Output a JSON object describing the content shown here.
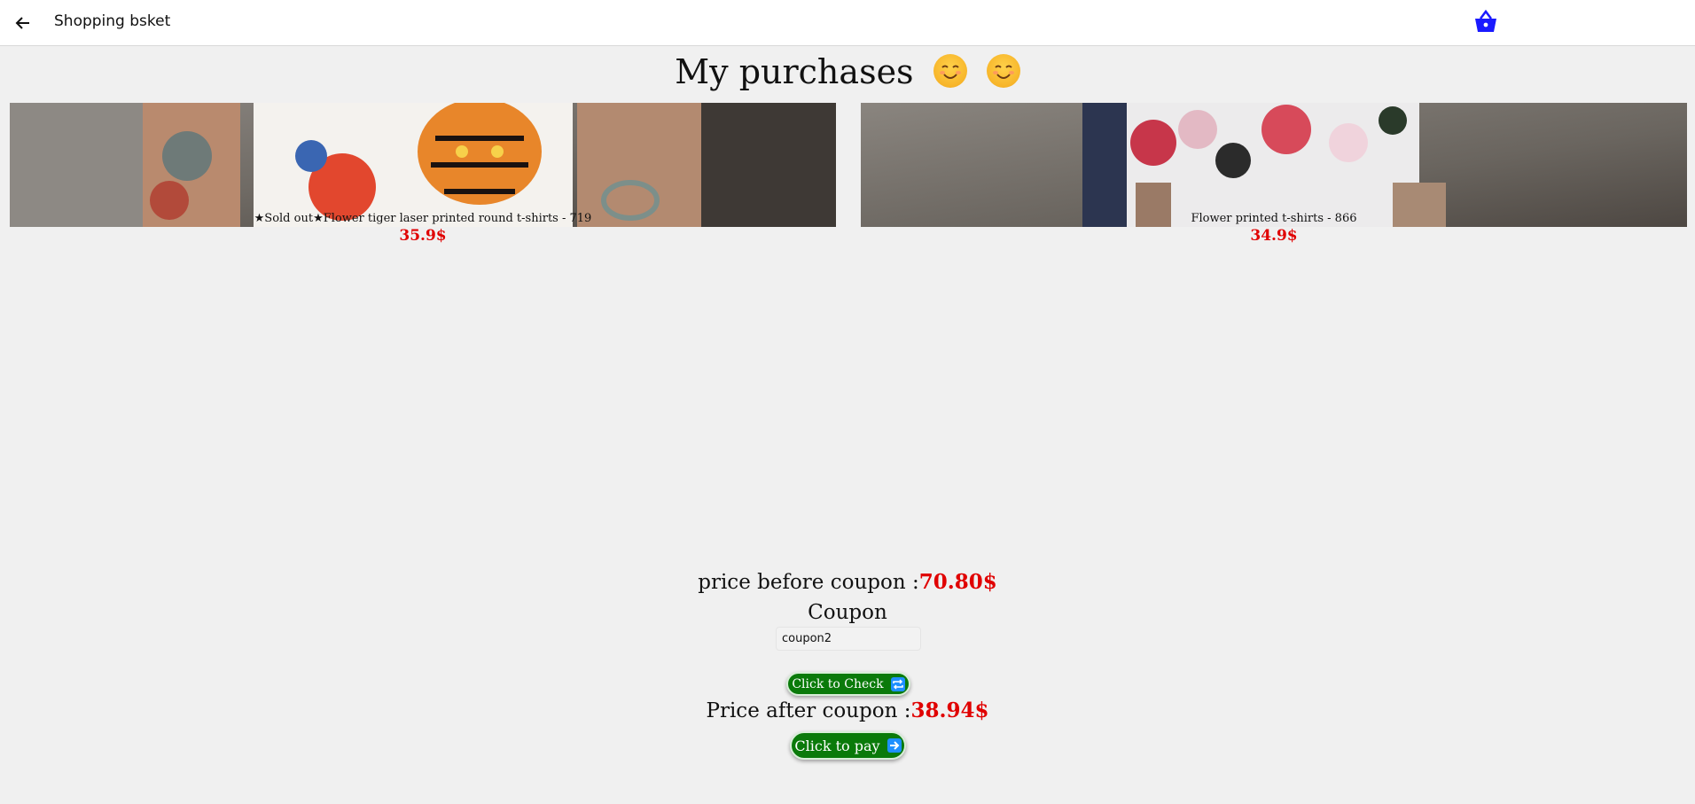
{
  "appbar": {
    "title": "Shopping bsket"
  },
  "page": {
    "title": "My purchases"
  },
  "products": [
    {
      "caption": "★Sold out★Flower tiger laser printed round t-shirts - 719",
      "price": "35.9$"
    },
    {
      "caption": "Flower printed t-shirts - 866",
      "price": "34.9$"
    }
  ],
  "summary": {
    "before_label": "price before coupon :",
    "before_value": "70.80$",
    "coupon_label": "Coupon",
    "coupon_value": "coupon2",
    "check_button": "Click to Check",
    "after_label": "Price after coupon :",
    "after_value": "38.94$",
    "pay_button": "Click to pay"
  },
  "colors": {
    "price": "#e00000",
    "button": "#0a7a0a",
    "basket_icon": "#1a1aff"
  },
  "icons": [
    "back-arrow-icon",
    "basket-icon",
    "smiling-face-icon",
    "repeat-icon",
    "right-arrow-icon"
  ]
}
